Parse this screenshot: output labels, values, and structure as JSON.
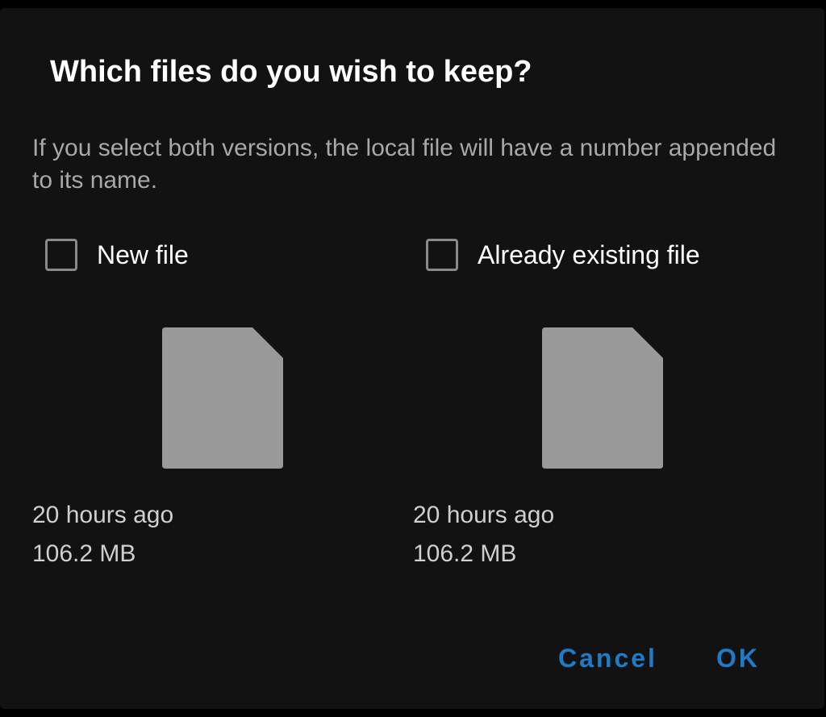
{
  "dialog": {
    "title": "Which files do you wish to keep?",
    "message": "If you select both versions, the local file will have a number appended to its name."
  },
  "options": [
    {
      "label": "New file",
      "checked": false,
      "icon": "file-icon",
      "modified": "20 hours ago",
      "size": "106.2 MB"
    },
    {
      "label": "Already existing file",
      "checked": false,
      "icon": "file-icon",
      "modified": "20 hours ago",
      "size": "106.2 MB"
    }
  ],
  "buttons": {
    "cancel": "Cancel",
    "ok": "OK"
  },
  "colors": {
    "background": "#121212",
    "accent": "#1f7bc7",
    "file_icon": "#999999"
  }
}
